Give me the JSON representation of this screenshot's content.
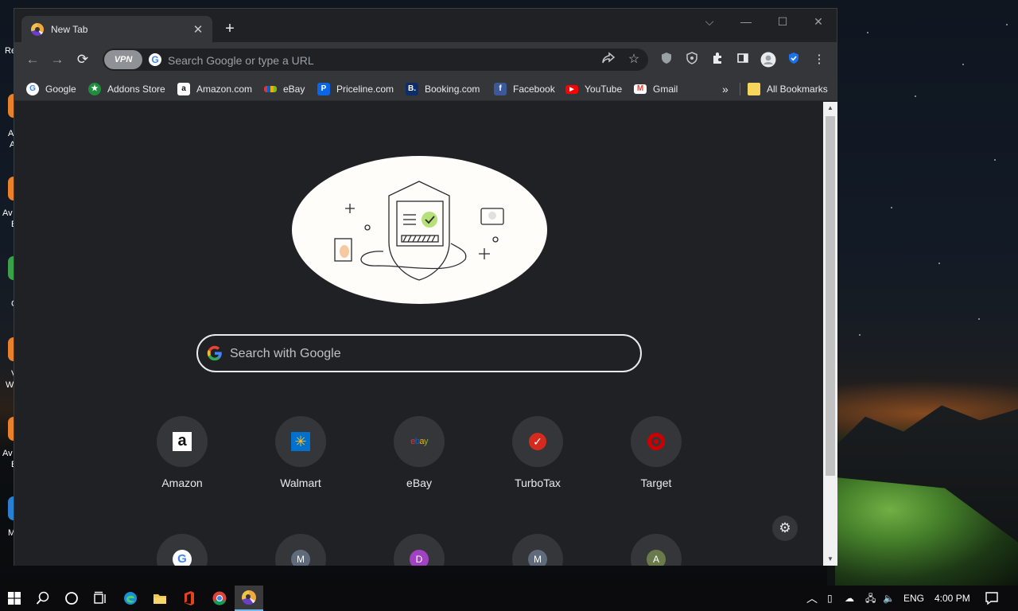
{
  "desktop": {
    "labels": [
      "Re",
      "A",
      "A",
      "Av",
      "E",
      "C",
      "V",
      "W",
      "Av",
      "E",
      "M"
    ]
  },
  "browser": {
    "tab": {
      "title": "New Tab",
      "close": "✕"
    },
    "new_tab_button": "+",
    "window_controls": {
      "dropdown": "⌵",
      "minimize": "—",
      "maximize": "☐",
      "close": "✕"
    },
    "toolbar": {
      "back": "←",
      "forward": "→",
      "reload": "⟳",
      "vpn_label": "VPN",
      "omnibox_placeholder": "Search Google or type a URL",
      "menu": "⋮"
    },
    "bookmarks": [
      {
        "label": "Google",
        "icon": "google-icon",
        "color": "#ffffff"
      },
      {
        "label": "Addons Store",
        "icon": "addons-store-icon",
        "color": "#1e8e3e"
      },
      {
        "label": "Amazon.com",
        "icon": "amazon-icon",
        "color": "#ffffff"
      },
      {
        "label": "eBay",
        "icon": "ebay-icon",
        "color": "#e53238"
      },
      {
        "label": "Priceline.com",
        "icon": "priceline-icon",
        "color": "#0a66e4"
      },
      {
        "label": "Booking.com",
        "icon": "booking-icon",
        "color": "#0c2d6b"
      },
      {
        "label": "Facebook",
        "icon": "facebook-icon",
        "color": "#3b5998"
      },
      {
        "label": "YouTube",
        "icon": "youtube-icon",
        "color": "#ff0000"
      },
      {
        "label": "Gmail",
        "icon": "gmail-icon",
        "color": "#ffffff"
      }
    ],
    "bookmarks_overflow": "»",
    "all_bookmarks": "All Bookmarks"
  },
  "newtab": {
    "search_placeholder": "Search with Google",
    "shortcuts_row1": [
      {
        "label": "Amazon",
        "icon": "amazon-icon"
      },
      {
        "label": "Walmart",
        "icon": "walmart-icon"
      },
      {
        "label": "eBay",
        "icon": "ebay-icon",
        "logo_text": "ebay"
      },
      {
        "label": "TurboTax",
        "icon": "turbotax-icon"
      },
      {
        "label": "Target",
        "icon": "target-icon"
      }
    ],
    "shortcuts_row2": [
      {
        "letter": "G",
        "color": "#ffffff"
      },
      {
        "letter": "M",
        "color": "#5f6b7a"
      },
      {
        "letter": "D",
        "color": "#a142c3"
      },
      {
        "letter": "M",
        "color": "#5f6b7a"
      },
      {
        "letter": "A",
        "color": "#6b7a4a"
      }
    ],
    "customize_icon": "⚙"
  },
  "taskbar": {
    "language": "ENG",
    "time": "4:00 PM"
  },
  "colors": {
    "tab_bg": "#35363a",
    "frame_bg": "#202124",
    "accent_blue": "#1a73e8"
  }
}
